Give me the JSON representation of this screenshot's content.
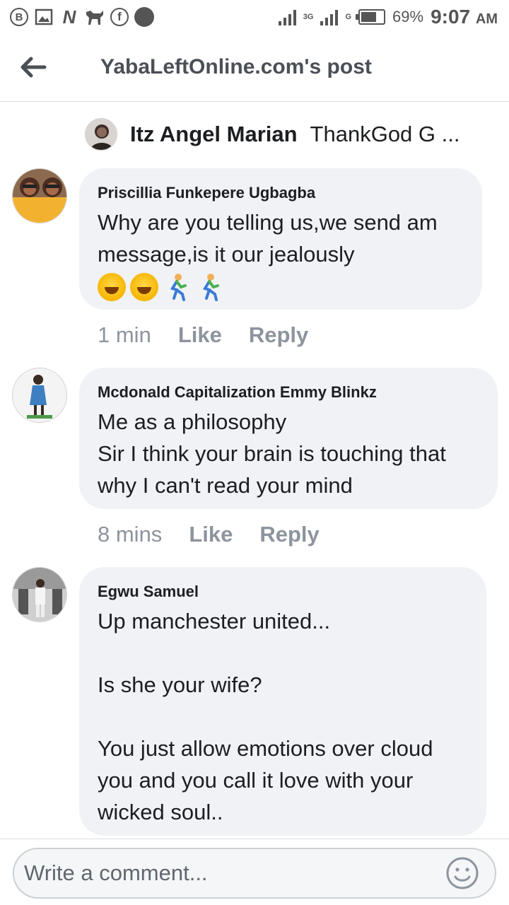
{
  "status_bar": {
    "left_icons": [
      "b-icon",
      "image-icon",
      "n-icon",
      "dog-icon",
      "facebook-icon",
      "dot-icon"
    ],
    "network1": "3G",
    "network2": "G",
    "battery_percent": "69%",
    "time": "9:07",
    "ampm": "AM",
    "battery_level": 0.69
  },
  "header": {
    "title": "YabaLeftOnline.com's post"
  },
  "reply_preview": {
    "name": "Itz Angel Marian",
    "text": "ThankGod G ..."
  },
  "comments": [
    {
      "author": "Priscillia Funkepere Ugbagba",
      "text": "Why are you telling us,we send am message,is it our jealously",
      "emojis": [
        "laughing-icon",
        "laughing-icon",
        "running-man-icon",
        "running-man-icon"
      ],
      "time": "1 min",
      "like": "Like",
      "reply": "Reply"
    },
    {
      "author": "Mcdonald Capitalization Emmy Blinkz",
      "text": "Me as a philosophy\nSir I think your brain is touching that why I can't read your mind",
      "time": "8 mins",
      "like": "Like",
      "reply": "Reply"
    },
    {
      "author": "Egwu Samuel",
      "text": "Up manchester united...\n\nIs she your wife?\n\nYou just allow emotions over cloud you and you call it love with your wicked soul..",
      "time": "",
      "like": "",
      "reply": ""
    }
  ],
  "composer": {
    "placeholder": "Write a comment..."
  },
  "colors": {
    "bubble_bg": "#f0f2f5",
    "meta_gray": "#8d949e",
    "header_gray": "#4b4f56",
    "text": "#1c1e21"
  }
}
